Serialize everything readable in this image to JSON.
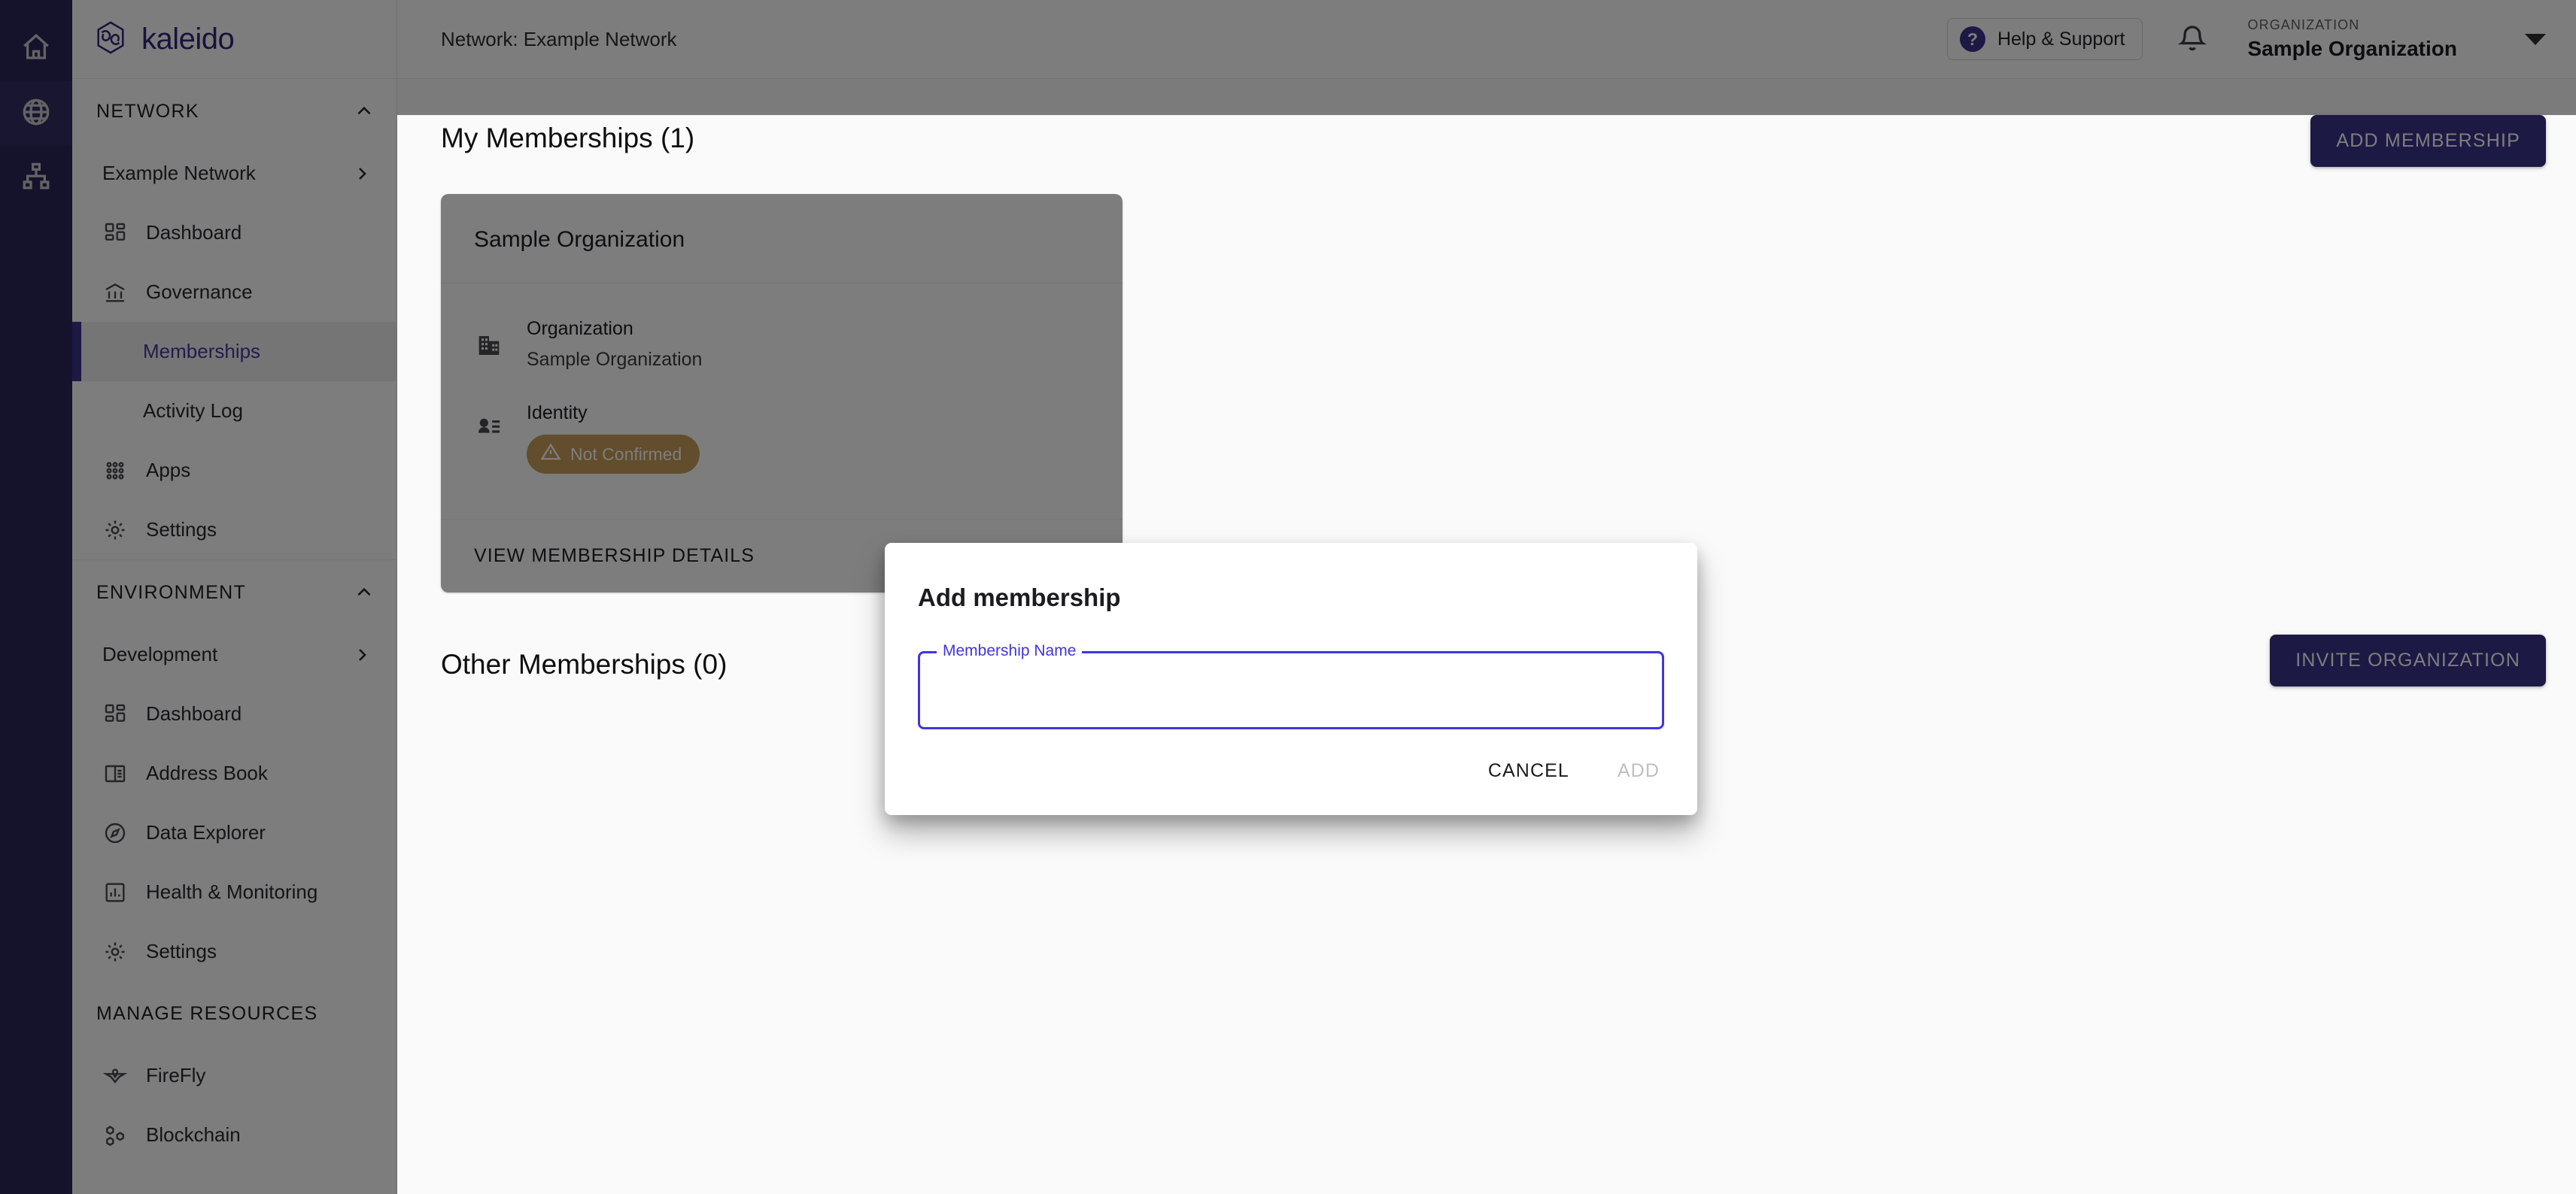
{
  "brand": {
    "name": "kaleido",
    "logo_icon": "kaleido-hex-logo"
  },
  "rail": {
    "items": [
      {
        "name": "home",
        "icon": "home-icon"
      },
      {
        "name": "globe",
        "icon": "globe-icon"
      },
      {
        "name": "network",
        "icon": "network-hierarchy-icon"
      }
    ]
  },
  "sidebar": {
    "network_section": {
      "label": "NETWORK",
      "collapse_icon": "chevron-up-icon",
      "selector": {
        "label": "Example Network",
        "icon": "chevron-right-icon"
      },
      "items": [
        {
          "label": "Dashboard",
          "icon": "dashboard-icon",
          "selected": false
        },
        {
          "label": "Governance",
          "icon": "bank-icon",
          "selected": false
        },
        {
          "label": "Memberships",
          "icon": "",
          "selected": true
        },
        {
          "label": "Activity Log",
          "icon": "",
          "selected": false
        },
        {
          "label": "Apps",
          "icon": "apps-grid-icon",
          "selected": false
        },
        {
          "label": "Settings",
          "icon": "gear-icon",
          "selected": false
        }
      ]
    },
    "environment_section": {
      "label": "ENVIRONMENT",
      "collapse_icon": "chevron-up-icon",
      "selector": {
        "label": "Development",
        "icon": "chevron-right-icon"
      },
      "items": [
        {
          "label": "Dashboard",
          "icon": "dashboard-icon"
        },
        {
          "label": "Address Book",
          "icon": "address-book-icon"
        },
        {
          "label": "Data Explorer",
          "icon": "compass-icon"
        },
        {
          "label": "Health & Monitoring",
          "icon": "bar-chart-icon"
        },
        {
          "label": "Settings",
          "icon": "gear-icon"
        }
      ]
    },
    "manage_resources_section": {
      "label": "MANAGE RESOURCES",
      "items": [
        {
          "label": "FireFly",
          "icon": "firefly-icon"
        },
        {
          "label": "Blockchain",
          "icon": "blockchain-hex-icon"
        }
      ]
    }
  },
  "topbar": {
    "network_label": "Network: Example Network",
    "help_button": "Help & Support",
    "help_icon": "question-circle-icon",
    "notifications_icon": "bell-icon",
    "org_caption": "ORGANIZATION",
    "org_name": "Sample Organization",
    "org_caret_icon": "caret-down-icon"
  },
  "main": {
    "my_memberships_title": "My Memberships (1)",
    "add_membership_button": "ADD MEMBERSHIP",
    "other_memberships_title": "Other Memberships (0)",
    "invite_organization_button": "INVITE ORGANIZATION",
    "membership_card": {
      "title": "Sample Organization",
      "organization_label": "Organization",
      "organization_icon": "building-icon",
      "organization_value": "Sample Organization",
      "identity_label": "Identity",
      "identity_icon": "identity-badge-icon",
      "identity_status": "Not Confirmed",
      "identity_status_icon": "warning-triangle-icon",
      "view_details_link": "VIEW MEMBERSHIP DETAILS"
    }
  },
  "dialog": {
    "title": "Add membership",
    "field_label": "Membership Name",
    "field_value": "",
    "field_placeholder": "",
    "cancel_button": "CANCEL",
    "add_button": "ADD"
  },
  "colors": {
    "brand_purple": "#3b2fbe",
    "rail_navy": "#2b2273",
    "focus_purple": "#4135dd",
    "warning_orange": "#e09b2d"
  }
}
